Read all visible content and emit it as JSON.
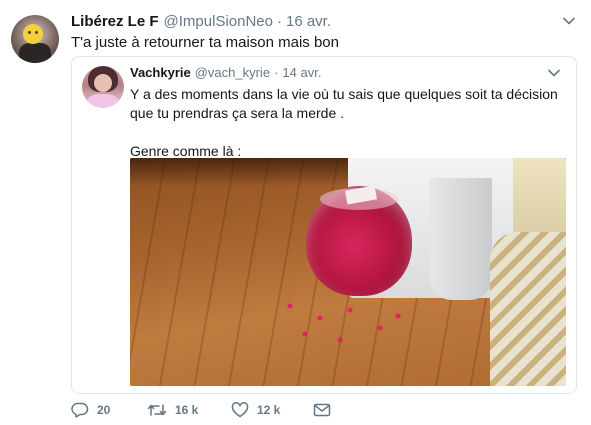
{
  "tweet": {
    "author_name": "Libérez Le F",
    "author_handle": "@ImpulSionNeo",
    "separator": "·",
    "time": "16 avr.",
    "text": "T'a juste à retourner ta maison mais bon"
  },
  "quoted": {
    "author_name": "Vachkyrie",
    "author_handle": "@vach_kyrie",
    "separator": "·",
    "time": "14 avr.",
    "text_line1": "Y a des moments dans la vie où tu sais que quelques soit ta décision que tu prendras ça sera la merde .",
    "text_line2": "Genre comme là :"
  },
  "actions": {
    "reply_count": "20",
    "retweet_count": "16 k",
    "like_count": "12 k"
  },
  "icons": {
    "menu": "chevron-down-icon",
    "reply": "reply-icon",
    "retweet": "retweet-icon",
    "like": "heart-icon",
    "message": "envelope-icon"
  },
  "colors": {
    "text": "#14171a",
    "secondary": "#657786",
    "border": "#e1e8ed"
  }
}
